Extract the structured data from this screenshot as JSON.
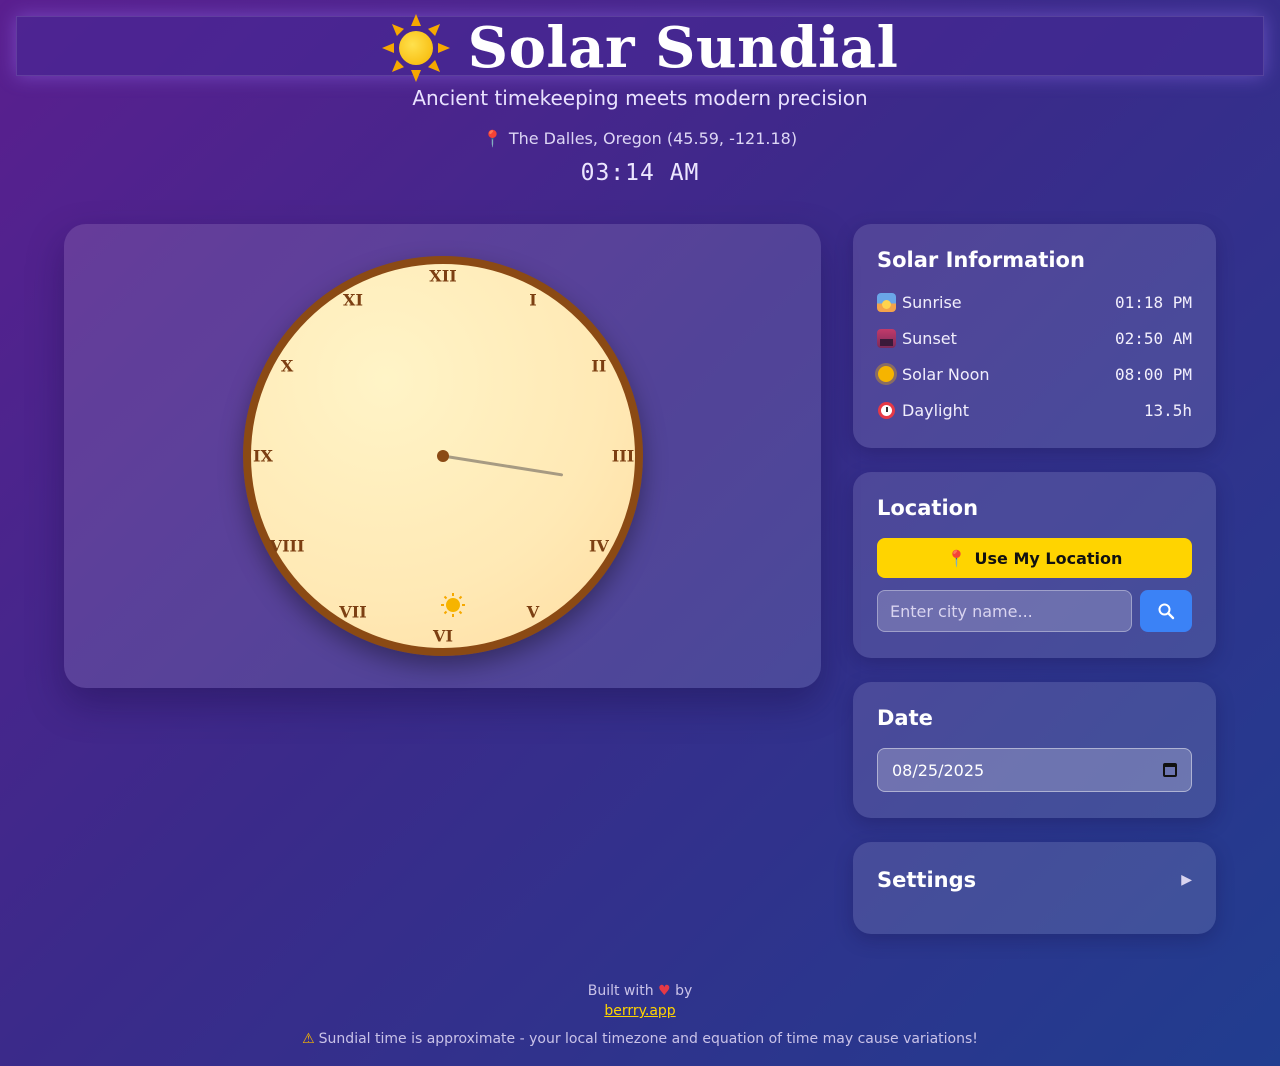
{
  "header": {
    "title": "Solar Sundial",
    "subtitle": "Ancient timekeeping meets modern precision",
    "location": "The Dalles, Oregon (45.59, -121.18)",
    "time": "03:14 AM"
  },
  "dial": {
    "numerals": [
      "XII",
      "I",
      "II",
      "III",
      "IV",
      "V",
      "VI",
      "VII",
      "VIII",
      "IX",
      "X",
      "XI"
    ],
    "shadow_hour": 3.3,
    "sun_marker": "sun-icon"
  },
  "solar_info": {
    "title": "Solar Information",
    "rows": [
      {
        "label": "Sunrise",
        "value": "01:18 PM",
        "icon": "sunrise-icon"
      },
      {
        "label": "Sunset",
        "value": "02:50 AM",
        "icon": "sunset-icon"
      },
      {
        "label": "Solar Noon",
        "value": "08:00 PM",
        "icon": "sun-icon"
      },
      {
        "label": "Daylight",
        "value": "13.5h",
        "icon": "alarm-clock-icon"
      }
    ]
  },
  "location": {
    "title": "Location",
    "use_location_label": "Use My Location",
    "city_placeholder": "Enter city name...",
    "search_icon": "search-icon"
  },
  "date": {
    "title": "Date",
    "value": "08/25/2025"
  },
  "settings": {
    "title": "Settings",
    "collapsed": true
  },
  "footer": {
    "built_with": "Built with",
    "by": "by",
    "link_text": "berrry.app",
    "warning": "Sundial time is approximate - your local timezone and equation of time may cause variations!"
  },
  "colors": {
    "accent_yellow": "#ffd400",
    "search_blue": "#3b82f6",
    "dial_rim": "#8b4a14",
    "numeral": "#7c3f12"
  }
}
